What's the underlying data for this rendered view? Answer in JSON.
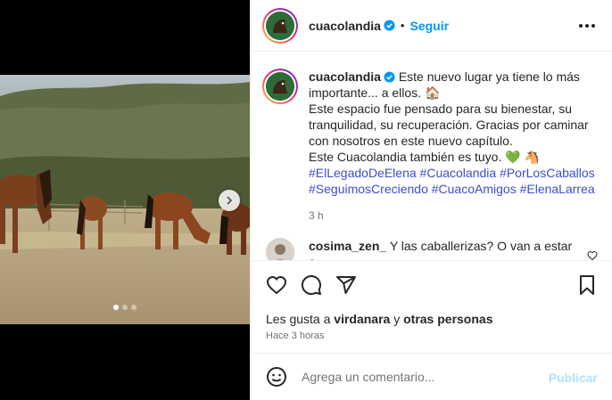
{
  "post": {
    "username": "cuacolandia",
    "separator": "•",
    "follow_label": "Seguir",
    "more_icon": "more-horizontal-icon"
  },
  "caption": {
    "username": "cuacolandia",
    "line1": "Este nuevo lugar ya tiene lo más importante... a ellos. 🏠",
    "line2": "Este espacio fue pensado para su bienestar, su tranquilidad, su recuperación. Gracias por caminar con nosotros en este nuevo capítulo.",
    "line3": "Este Cuacolandia también es tuyo. 💚 🐴",
    "hashtags": [
      "#ElLegadoDeElena",
      "#Cuacolandia",
      "#PorLosCaballos",
      "#SeguimosCreciendo",
      "#CuacoAmigos",
      "#ElenaLarrea"
    ],
    "time": "3 h"
  },
  "comment": {
    "username": "cosima_zen_",
    "text": "Y las caballerizas? O van a estar a"
  },
  "likes": {
    "prefix": "Les gusta a ",
    "user": "virdanara",
    "connector": " y ",
    "others": "otras personas"
  },
  "posted_ago": "Hace 3 horas",
  "add_comment": {
    "placeholder": "Agrega un comentario...",
    "publish_label": "Publicar"
  },
  "carousel": {
    "total_slides": 3,
    "active_slide": 1
  },
  "colors": {
    "accent": "#0095f6",
    "hashtag": "#3d4fc4",
    "muted": "#737373",
    "publish_disabled": "#b2dffc"
  }
}
